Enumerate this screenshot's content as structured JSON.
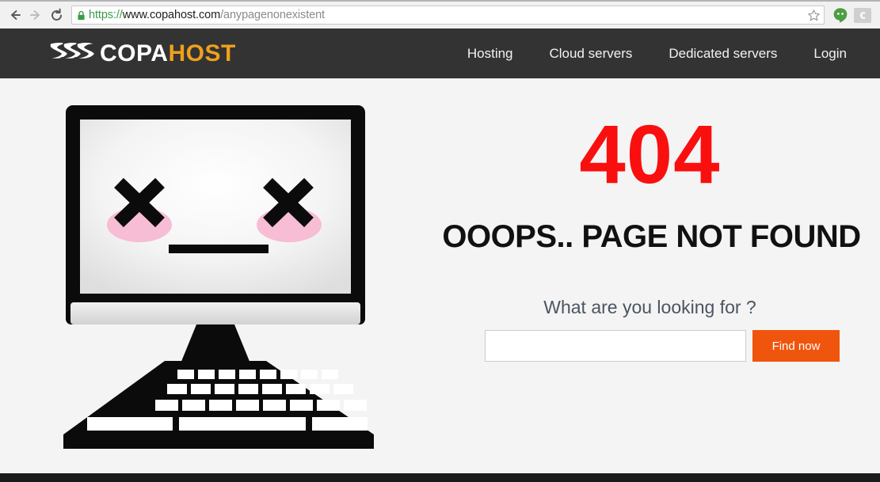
{
  "browser": {
    "back_icon": "back-arrow-icon",
    "forward_icon": "forward-arrow-icon",
    "reload_icon": "reload-icon",
    "lock_icon": "secure-lock-icon",
    "star_icon": "bookmark-star-icon",
    "hangouts_icon": "hangouts-icon",
    "extension_icon": "extension-icon",
    "url": {
      "full": "https://www.copahost.com/anypagenonexistent",
      "scheme": "https://",
      "host": "www.copahost.com",
      "path": "/anypagenonexistent"
    }
  },
  "header": {
    "logo": {
      "mark": "copahost-swoosh-logo",
      "text_primary": "COPA",
      "text_accent": "HOST",
      "accent_color": "#efa01c"
    },
    "nav": [
      {
        "label": "Hosting"
      },
      {
        "label": "Cloud servers"
      },
      {
        "label": "Dedicated servers"
      },
      {
        "label": "Login"
      }
    ]
  },
  "main": {
    "illustration": "sad-monitor-x-eyes-keyboard",
    "error_code": "404",
    "error_headline": "OOOPS.. PAGE NOT FOUND",
    "search_prompt": "What are you looking for ?",
    "search_value": "",
    "search_placeholder": "",
    "search_button": "Find now",
    "error_color": "#fa0f0f",
    "button_color": "#f0550d"
  }
}
